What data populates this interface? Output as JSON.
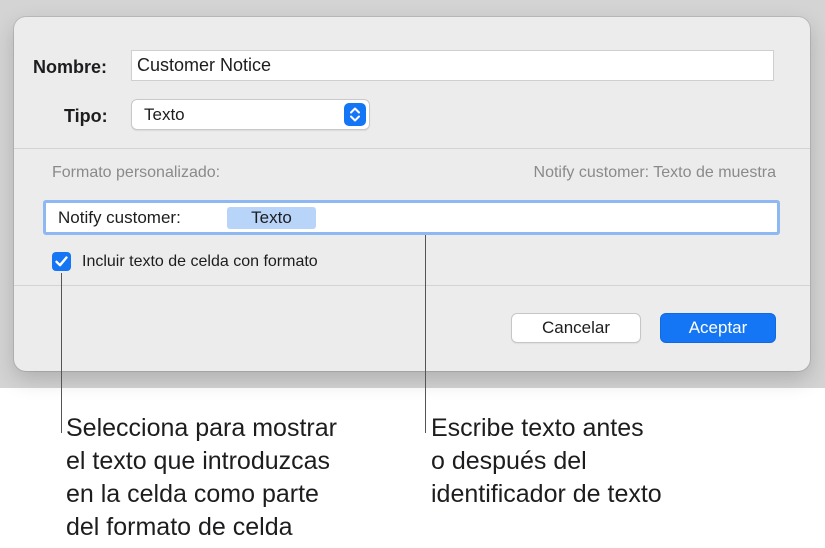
{
  "dialog": {
    "name_label": "Nombre:",
    "name_value": "Customer Notice",
    "type_label": "Tipo:",
    "type_value": "Texto",
    "custom_format_label": "Formato personalizado:",
    "sample_preview": "Notify customer: Texto de muestra",
    "format_prefix": "Notify customer:",
    "format_token": "Texto",
    "include_checkbox_label": "Incluir texto de celda con formato",
    "include_checked": true,
    "cancel_label": "Cancelar",
    "ok_label": "Aceptar"
  },
  "callouts": {
    "left_lines": [
      "Selecciona para mostrar",
      "el texto que introduzcas",
      "en la celda como parte",
      "del formato de celda"
    ],
    "right_lines": [
      "Escribe texto antes",
      "o después del",
      "identificador de texto"
    ]
  },
  "colors": {
    "accent": "#1476f5",
    "token_bg": "#b8d4f9",
    "focus_ring": "#8db8f2",
    "dialog_bg": "#ececec",
    "backdrop": "#d4d4d4"
  },
  "icons": {
    "type_stepper": "chevron-up-down-icon",
    "checkbox": "checkmark-icon"
  }
}
